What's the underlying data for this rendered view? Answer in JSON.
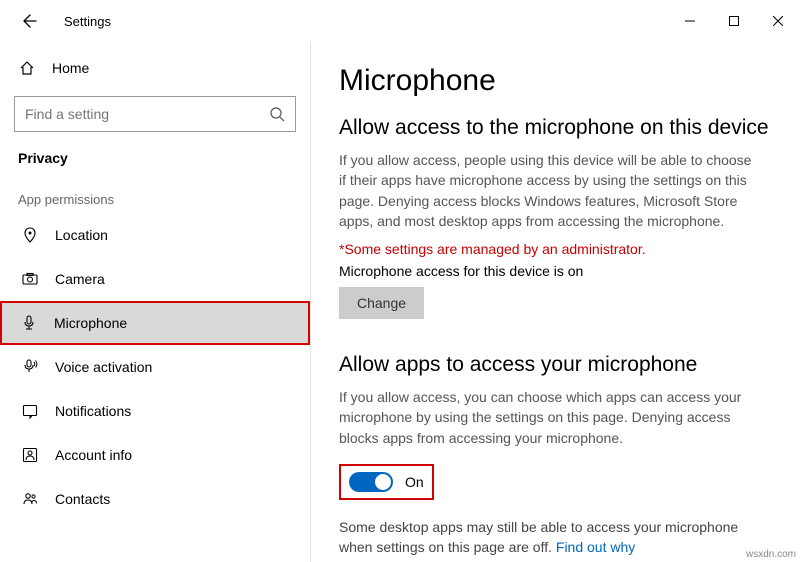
{
  "titlebar": {
    "title": "Settings"
  },
  "sidebar": {
    "home": "Home",
    "search_placeholder": "Find a setting",
    "category": "Privacy",
    "group": "App permissions",
    "items": [
      {
        "label": "Location"
      },
      {
        "label": "Camera"
      },
      {
        "label": "Microphone"
      },
      {
        "label": "Voice activation"
      },
      {
        "label": "Notifications"
      },
      {
        "label": "Account info"
      },
      {
        "label": "Contacts"
      }
    ]
  },
  "content": {
    "page_title": "Microphone",
    "section1": {
      "heading": "Allow access to the microphone on this device",
      "desc": "If you allow access, people using this device will be able to choose if their apps have microphone access by using the settings on this page. Denying access blocks Windows features, Microsoft Store apps, and most desktop apps from accessing the microphone.",
      "warning": "*Some settings are managed by an administrator.",
      "status": "Microphone access for this device is on",
      "change_btn": "Change"
    },
    "section2": {
      "heading": "Allow apps to access your microphone",
      "desc": "If you allow access, you can choose which apps can access your microphone by using the settings on this page. Denying access blocks apps from accessing your microphone.",
      "toggle_label": "On",
      "footer_note": "Some desktop apps may still be able to access your microphone when settings on this page are off. ",
      "footer_link": "Find out why"
    }
  },
  "watermark": "wsxdn.com"
}
